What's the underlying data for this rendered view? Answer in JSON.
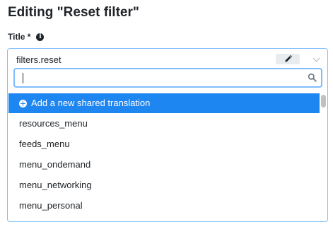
{
  "page": {
    "title": "Editing \"Reset filter\""
  },
  "field": {
    "label": "Title *",
    "info_icon": "info-icon",
    "selected_value": "filters.reset",
    "edit_icon": "pencil-icon",
    "dropdown_icon": "chevron-down-icon"
  },
  "search": {
    "value": "",
    "placeholder": "",
    "icon": "search-icon"
  },
  "options": [
    {
      "label": "Add a new shared translation",
      "icon": "plus-circle-icon",
      "highlighted": true
    },
    {
      "label": "resources_menu"
    },
    {
      "label": "feeds_menu"
    },
    {
      "label": "menu_ondemand"
    },
    {
      "label": "menu_networking"
    },
    {
      "label": "menu_personal"
    }
  ],
  "colors": {
    "accent": "#1e86f0",
    "focus_border": "#80bdff"
  }
}
